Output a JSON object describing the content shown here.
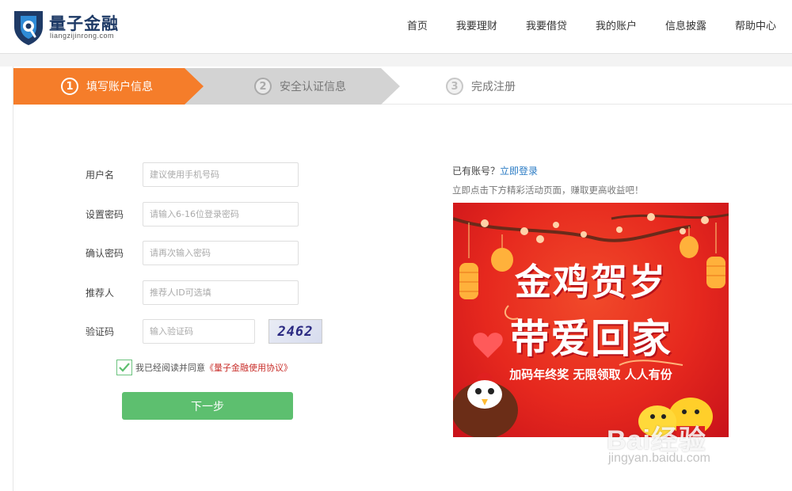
{
  "header": {
    "brand_name": "量子金融",
    "brand_sub": "liangzijinrong.com",
    "nav": [
      "首页",
      "我要理财",
      "我要借贷",
      "我的账户",
      "信息披露",
      "帮助中心"
    ]
  },
  "steps": [
    {
      "num": "1",
      "label": "填写账户信息",
      "state": "active"
    },
    {
      "num": "2",
      "label": "安全认证信息",
      "state": "pending"
    },
    {
      "num": "3",
      "label": "完成注册",
      "state": "pending"
    }
  ],
  "form": {
    "username": {
      "label": "用户名",
      "placeholder": "建议使用手机号码"
    },
    "password": {
      "label": "设置密码",
      "placeholder": "请输入6-16位登录密码"
    },
    "confirm": {
      "label": "确认密码",
      "placeholder": "请再次输入密码"
    },
    "referrer": {
      "label": "推荐人",
      "placeholder": "推荐人ID可选填"
    },
    "captcha": {
      "label": "验证码",
      "placeholder": "输入验证码",
      "code": "2462"
    },
    "agree_text": "我已经阅读并同意",
    "agree_link": "《量子金融使用协议》",
    "agree_checked": true,
    "next_label": "下一步"
  },
  "side": {
    "have_account": "已有账号？",
    "login_link": "立即登录",
    "promo_tip": "立即点击下方精彩活动页面，赚取更高收益吧！"
  },
  "banner": {
    "line1": "金鸡贺岁",
    "line2": "带爱回家",
    "line3": "加码年终奖 无限领取 人人有份"
  },
  "watermark": {
    "brand": "Bai经验",
    "url": "jingyan.baidu.com"
  },
  "colors": {
    "active_step": "#f57d2a",
    "pending_step": "#d3d3d3",
    "button": "#5dbf6f",
    "link": "#2a7bc4",
    "agree_link": "#c9302c",
    "brand": "#1e3a66"
  }
}
